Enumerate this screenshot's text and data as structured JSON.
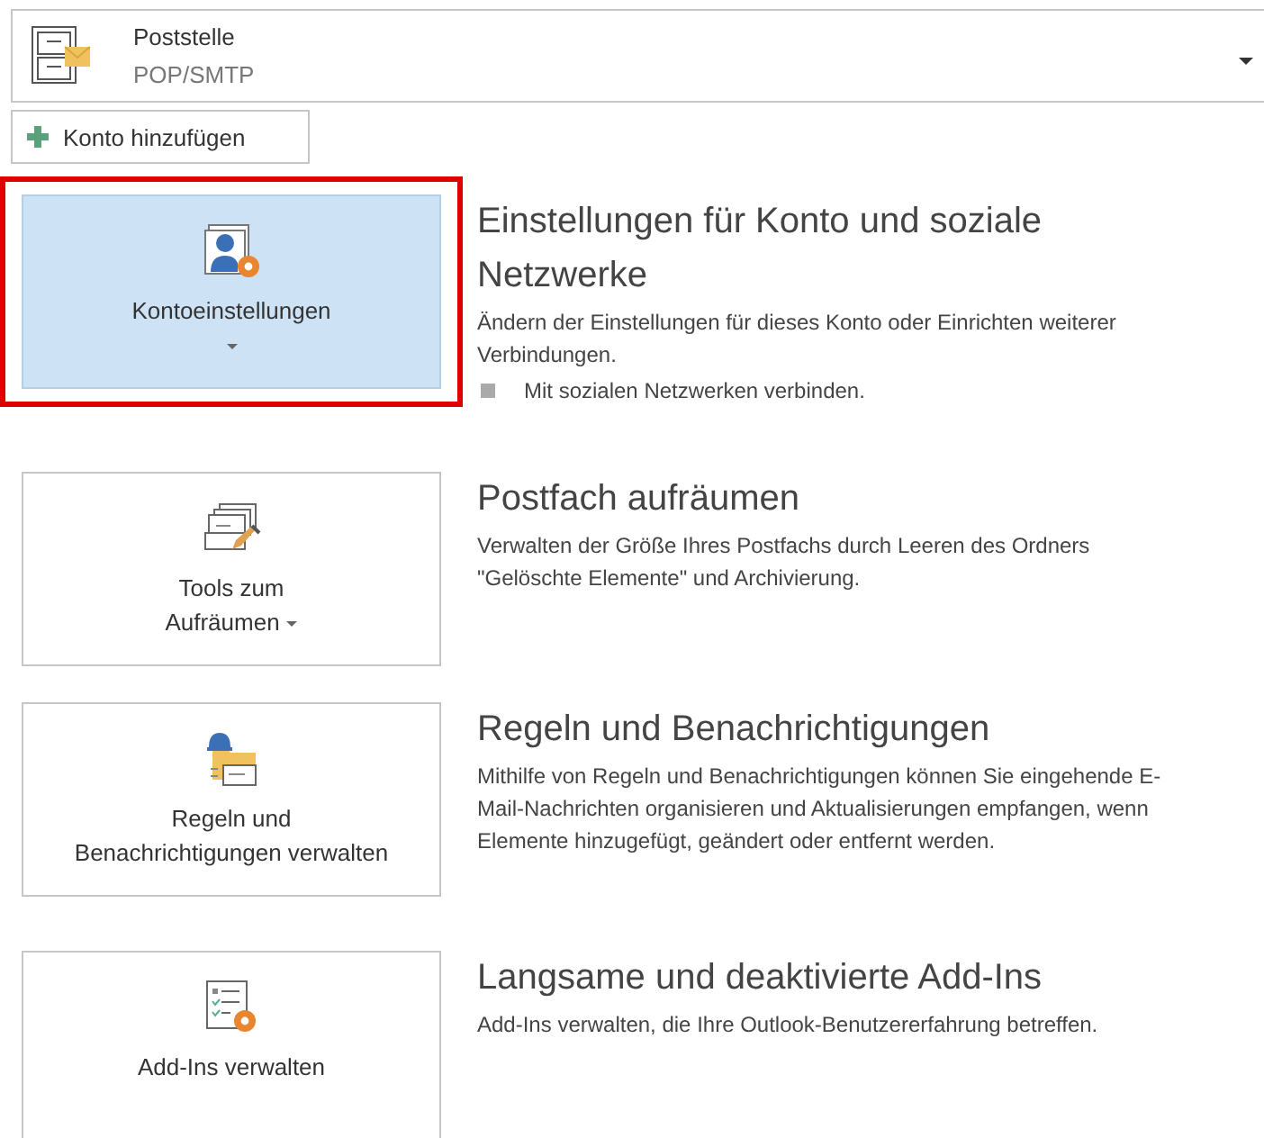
{
  "account": {
    "name": "Poststelle",
    "type": "POP/SMTP"
  },
  "add_account_button": {
    "label": "Konto hinzufügen"
  },
  "sections": [
    {
      "button": {
        "lines": [
          "Kontoeinstellungen"
        ],
        "has_dropdown": true,
        "selected": true,
        "highlighted": true
      },
      "title": "Einstellungen für Konto und soziale Netzwerke",
      "description": "Ändern der Einstellungen für dieses Konto oder Einrichten weiterer Verbindungen.",
      "links": [
        "Mit sozialen Netzwerken verbinden."
      ]
    },
    {
      "button": {
        "lines": [
          "Tools zum",
          "Aufräumen"
        ],
        "has_dropdown": true,
        "selected": false,
        "highlighted": false
      },
      "title": "Postfach aufräumen",
      "description": "Verwalten der Größe Ihres Postfachs durch Leeren des Ordners \"Gelöschte Elemente\" und Archivierung."
    },
    {
      "button": {
        "lines": [
          "Regeln und",
          "Benachrichtigungen verwalten"
        ],
        "has_dropdown": false,
        "selected": false,
        "highlighted": false
      },
      "title": "Regeln und Benachrichtigungen",
      "description": "Mithilfe von Regeln und Benachrichtigungen können Sie eingehende E-Mail-Nachrichten organisieren und Aktualisierungen empfangen, wenn Elemente hinzugefügt, geändert oder entfernt werden."
    },
    {
      "button": {
        "lines": [
          "Add-Ins verwalten"
        ],
        "has_dropdown": false,
        "selected": false,
        "highlighted": false
      },
      "title": "Langsame und deaktivierte Add-Ins",
      "description": "Add-Ins verwalten, die Ihre Outlook-Benutzererfahrung betreffen."
    }
  ]
}
